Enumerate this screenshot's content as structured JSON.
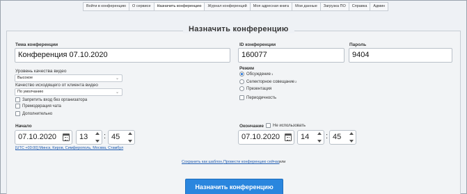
{
  "nav": {
    "tabs": [
      {
        "label": "Войти в конференцию",
        "active": false
      },
      {
        "label": "О сервисе",
        "active": false
      },
      {
        "label": "Назначить конференцию",
        "active": true
      },
      {
        "label": "Журнал конференций",
        "active": false
      },
      {
        "label": "Моя адресная книга",
        "active": false
      },
      {
        "label": "Мои данные",
        "active": false
      },
      {
        "label": "Загрузка ПО",
        "active": false
      },
      {
        "label": "Справка",
        "active": false
      },
      {
        "label": "Админ",
        "active": false
      }
    ]
  },
  "panel": {
    "title": "Назначить конференцию"
  },
  "topic": {
    "label": "Тема конференции",
    "value": "Конференция 07.10.2020"
  },
  "conference_id": {
    "label": "ID конференции",
    "value": "160077"
  },
  "password": {
    "label": "Пароль",
    "value": "9404"
  },
  "video_quality": {
    "label": "Уровень качества видео",
    "value": "Высокое"
  },
  "client_video_quality": {
    "label": "Качество исходящего от клиента видео",
    "value": "По умолчанию"
  },
  "options": {
    "no_organizer": "Запретить вход без организатора",
    "chat_moderation": "Премодерация чата",
    "additional": "Дополнительно"
  },
  "mode": {
    "label": "Режим",
    "items": [
      {
        "label": "Обсуждение",
        "sup": "1",
        "selected": true
      },
      {
        "label": "Селекторное совещание",
        "sup": "2",
        "selected": false
      },
      {
        "label": "Презентация",
        "sup": "",
        "selected": false
      }
    ],
    "periodicity": "Периодичность"
  },
  "start": {
    "label": "Начало",
    "date": "07.10.2020",
    "hour": "13",
    "minute": "45",
    "timezone": "[UTC +03:00] Минск, Киров, Симферополь, Москва, Стамбул"
  },
  "end": {
    "label": "Окончание",
    "not_use": "Не использовать",
    "date": "07.10.2020",
    "hour": "14",
    "minute": "45"
  },
  "footer": {
    "save_template": "Сохранить как шаблон,",
    "run_now": "Провести конференцию сейчас",
    "or": "или"
  },
  "submit": {
    "label": "Назначить конференцию"
  }
}
